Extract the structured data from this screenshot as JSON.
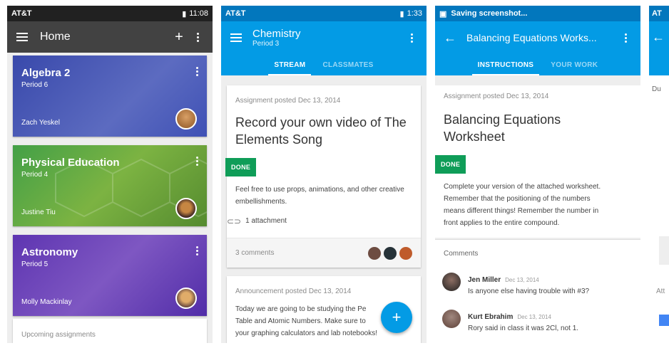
{
  "screen1": {
    "status": {
      "carrier": "AT&T",
      "time": "11:08"
    },
    "appbar": {
      "title": "Home",
      "add": "+"
    },
    "classes": [
      {
        "name": "Algebra 2",
        "period": "Period 6",
        "teacher": "Zach Yeskel",
        "color": "#3f51b5"
      },
      {
        "name": "Physical Education",
        "period": "Period 4",
        "teacher": "Justine Tiu",
        "color": "#4caf50"
      },
      {
        "name": "Astronomy",
        "period": "Period 5",
        "teacher": "Molly Mackinlay",
        "color": "#673ab7"
      }
    ],
    "upcoming": "Upcoming assignments"
  },
  "screen2": {
    "status": {
      "carrier": "AT&T",
      "time": "1:33"
    },
    "appbar": {
      "title": "Chemistry",
      "subtitle": "Period 3"
    },
    "tabs": {
      "stream": "STREAM",
      "classmates": "CLASSMATES"
    },
    "assignment": {
      "meta": "Assignment posted Dec 13, 2014",
      "title": "Record your own video of The Elements Song",
      "status": "DONE",
      "body": "Feel free to use props, animations, and other creative embellishments.",
      "attachment": "1 attachment",
      "comments": "3 comments"
    },
    "announcement": {
      "meta": "Announcement posted Dec 13, 2014",
      "line1": "Today we are going to be studying the Pe",
      "line2": "Table and Atomic Numbers. Make sure to",
      "line3": "your graphing calculators and lab notebooks!"
    },
    "fab": "+"
  },
  "screen3": {
    "status": {
      "title": "Saving screenshot..."
    },
    "appbar": {
      "title": "Balancing Equations Works..."
    },
    "tabs": {
      "instructions": "INSTRUCTIONS",
      "work": "YOUR WORK"
    },
    "assignment": {
      "meta": "Assignment posted Dec 13, 2014",
      "title_l1": "Balancing Equations",
      "title_l2": "Worksheet",
      "status": "DONE",
      "body_l1": "Complete your version of the attached worksheet.",
      "body_l2": "Remember that the positioning of the numbers",
      "body_l3": "means different things! Remember the number in",
      "body_l4": "front applies to the entire compound."
    },
    "comments_header": "Comments",
    "comments": [
      {
        "name": "Jen Miller",
        "date": "Dec 13, 2014",
        "text": "Is anyone else having trouble with #3?"
      },
      {
        "name": "Kurt Ebrahim",
        "date": "Dec 13, 2014",
        "text": "Rory said in class it was 2Cl, not 1."
      }
    ]
  },
  "screen4": {
    "status": {
      "carrier": "AT"
    },
    "due": "Du",
    "att": "Att"
  },
  "colors": {
    "dark_bar": "#424242",
    "blue_bar": "#039be5",
    "done_green": "#0f9d58"
  }
}
